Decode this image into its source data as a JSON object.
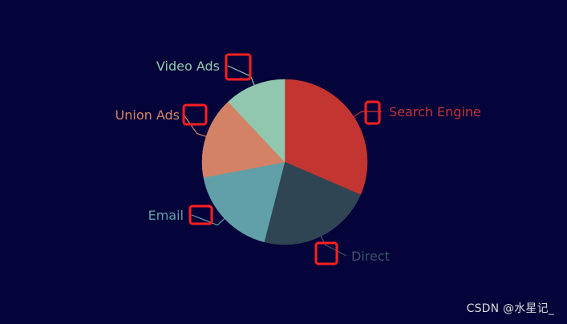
{
  "chart_data": {
    "type": "pie",
    "slices": [
      {
        "label": "Search Engine",
        "value": 31.5,
        "color": "#c23531"
      },
      {
        "label": "Direct",
        "value": 22.5,
        "color": "#2f4554"
      },
      {
        "label": "Email",
        "value": 18.0,
        "color": "#61a0a8"
      },
      {
        "label": "Union Ads",
        "value": 16.0,
        "color": "#d48265"
      },
      {
        "label": "Video Ads",
        "value": 12.0,
        "color": "#91c7ae"
      }
    ],
    "start_angle_deg": 0,
    "direction": "clockwise",
    "legend": "none",
    "labels": "outside",
    "label_line_color": "#8fb0c8",
    "highlight_box_color": "#ff1f1f"
  },
  "watermark": {
    "text": "CSDN @水星记_"
  }
}
